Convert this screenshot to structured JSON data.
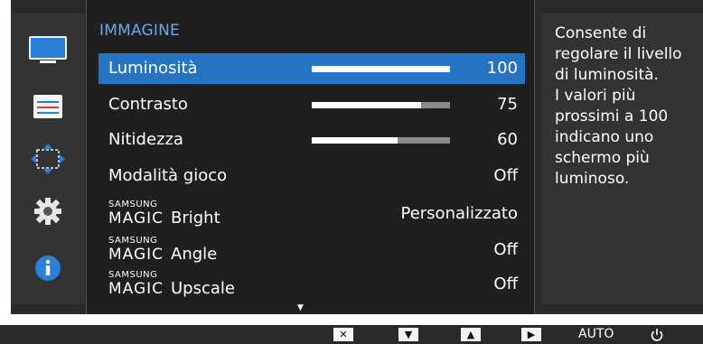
{
  "menu": {
    "title": "IMMAGINE",
    "items": [
      {
        "label": "Luminosità",
        "value": "100",
        "bar_fraction": 1.0,
        "selected": true
      },
      {
        "label": "Contrasto",
        "value": "75",
        "bar_fraction": 0.79,
        "selected": false
      },
      {
        "label": "Nitidezza",
        "value": "60",
        "bar_fraction": 0.62,
        "selected": false
      },
      {
        "label": "Modalità gioco",
        "value": "Off"
      },
      {
        "magic_small": "SAMSUNG",
        "magic_big": "MAGIC",
        "suffix": "Bright",
        "value": "Personalizzato"
      },
      {
        "magic_small": "SAMSUNG",
        "magic_big": "MAGIC",
        "suffix": "Angle",
        "value": "Off"
      },
      {
        "magic_small": "SAMSUNG",
        "magic_big": "MAGIC",
        "suffix": "Upscale",
        "value": "Off"
      }
    ],
    "scroll_indicator": "▼"
  },
  "help_text": "Consente di\nregolare il livello\ndi luminosità.\nI valori più\nprossimi a 100\nindicano uno\nschermo più\nluminoso.",
  "side_icons": [
    "monitor-icon",
    "settings-sliders-icon",
    "resize-arrows-icon",
    "gear-icon",
    "info-icon"
  ],
  "bottom_bar": {
    "close_glyph": "✕",
    "down_glyph": "▼",
    "up_glyph": "▲",
    "right_glyph": "▶",
    "auto_label": "AUTO",
    "power_icon": "power-icon"
  },
  "colors": {
    "accent": "#2773c3",
    "title": "#6aa8e2",
    "panel": "#1f1f1f",
    "frame": "#2a2a2a"
  }
}
